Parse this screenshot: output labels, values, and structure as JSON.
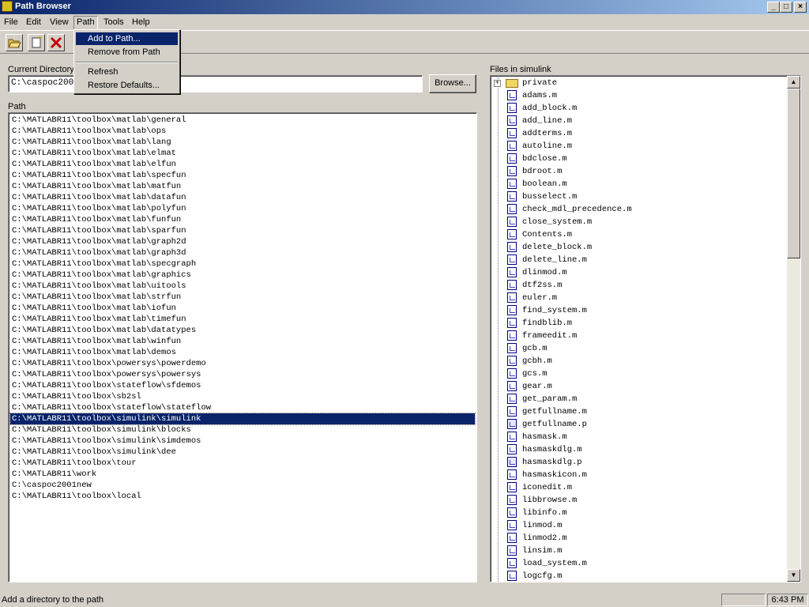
{
  "window": {
    "title": "Path Browser",
    "status": "Add a directory to the path",
    "time": "6:43 PM"
  },
  "menu": [
    "File",
    "Edit",
    "View",
    "Path",
    "Tools",
    "Help"
  ],
  "path_menu": {
    "add": "Add to Path...",
    "remove": "Remove from Path",
    "refresh": "Refresh",
    "restore": "Restore Defaults..."
  },
  "current_directory": {
    "label": "Current Directory",
    "value": "C:\\caspoc2001new",
    "browse": "Browse..."
  },
  "path": {
    "label": "Path",
    "selected_index": 27,
    "items": [
      "C:\\MATLABR11\\toolbox\\matlab\\general",
      "C:\\MATLABR11\\toolbox\\matlab\\ops",
      "C:\\MATLABR11\\toolbox\\matlab\\lang",
      "C:\\MATLABR11\\toolbox\\matlab\\elmat",
      "C:\\MATLABR11\\toolbox\\matlab\\elfun",
      "C:\\MATLABR11\\toolbox\\matlab\\specfun",
      "C:\\MATLABR11\\toolbox\\matlab\\matfun",
      "C:\\MATLABR11\\toolbox\\matlab\\datafun",
      "C:\\MATLABR11\\toolbox\\matlab\\polyfun",
      "C:\\MATLABR11\\toolbox\\matlab\\funfun",
      "C:\\MATLABR11\\toolbox\\matlab\\sparfun",
      "C:\\MATLABR11\\toolbox\\matlab\\graph2d",
      "C:\\MATLABR11\\toolbox\\matlab\\graph3d",
      "C:\\MATLABR11\\toolbox\\matlab\\specgraph",
      "C:\\MATLABR11\\toolbox\\matlab\\graphics",
      "C:\\MATLABR11\\toolbox\\matlab\\uitools",
      "C:\\MATLABR11\\toolbox\\matlab\\strfun",
      "C:\\MATLABR11\\toolbox\\matlab\\iofun",
      "C:\\MATLABR11\\toolbox\\matlab\\timefun",
      "C:\\MATLABR11\\toolbox\\matlab\\datatypes",
      "C:\\MATLABR11\\toolbox\\matlab\\winfun",
      "C:\\MATLABR11\\toolbox\\matlab\\demos",
      "C:\\MATLABR11\\toolbox\\powersys\\powerdemo",
      "C:\\MATLABR11\\toolbox\\powersys\\powersys",
      "C:\\MATLABR11\\toolbox\\stateflow\\sfdemos",
      "C:\\MATLABR11\\toolbox\\sb2sl",
      "C:\\MATLABR11\\toolbox\\stateflow\\stateflow",
      "C:\\MATLABR11\\toolbox\\simulink\\simulink",
      "C:\\MATLABR11\\toolbox\\simulink\\blocks",
      "C:\\MATLABR11\\toolbox\\simulink\\simdemos",
      "C:\\MATLABR11\\toolbox\\simulink\\dee",
      "C:\\MATLABR11\\toolbox\\tour",
      "C:\\MATLABR11\\work",
      "C:\\caspoc2001new",
      "C:\\MATLABR11\\toolbox\\local"
    ]
  },
  "files": {
    "label": "Files in simulink",
    "items": [
      {
        "name": "private",
        "kind": "folder"
      },
      {
        "name": "adams.m",
        "kind": "m"
      },
      {
        "name": "add_block.m",
        "kind": "m"
      },
      {
        "name": "add_line.m",
        "kind": "m"
      },
      {
        "name": "addterms.m",
        "kind": "m"
      },
      {
        "name": "autoline.m",
        "kind": "m"
      },
      {
        "name": "bdclose.m",
        "kind": "m"
      },
      {
        "name": "bdroot.m",
        "kind": "m"
      },
      {
        "name": "boolean.m",
        "kind": "m"
      },
      {
        "name": "busselect.m",
        "kind": "m"
      },
      {
        "name": "check_mdl_precedence.m",
        "kind": "m"
      },
      {
        "name": "close_system.m",
        "kind": "m"
      },
      {
        "name": "Contents.m",
        "kind": "m"
      },
      {
        "name": "delete_block.m",
        "kind": "m"
      },
      {
        "name": "delete_line.m",
        "kind": "m"
      },
      {
        "name": "dlinmod.m",
        "kind": "m"
      },
      {
        "name": "dtf2ss.m",
        "kind": "m"
      },
      {
        "name": "euler.m",
        "kind": "m"
      },
      {
        "name": "find_system.m",
        "kind": "m"
      },
      {
        "name": "findblib.m",
        "kind": "m"
      },
      {
        "name": "frameedit.m",
        "kind": "m"
      },
      {
        "name": "gcb.m",
        "kind": "m"
      },
      {
        "name": "gcbh.m",
        "kind": "m"
      },
      {
        "name": "gcs.m",
        "kind": "m"
      },
      {
        "name": "gear.m",
        "kind": "m"
      },
      {
        "name": "get_param.m",
        "kind": "m"
      },
      {
        "name": "getfullname.m",
        "kind": "m"
      },
      {
        "name": "getfullname.p",
        "kind": "p"
      },
      {
        "name": "hasmask.m",
        "kind": "m"
      },
      {
        "name": "hasmaskdlg.m",
        "kind": "m"
      },
      {
        "name": "hasmaskdlg.p",
        "kind": "p"
      },
      {
        "name": "hasmaskicon.m",
        "kind": "m"
      },
      {
        "name": "iconedit.m",
        "kind": "m"
      },
      {
        "name": "libbrowse.m",
        "kind": "m"
      },
      {
        "name": "libinfo.m",
        "kind": "m"
      },
      {
        "name": "linmod.m",
        "kind": "m"
      },
      {
        "name": "linmod2.m",
        "kind": "m"
      },
      {
        "name": "linsim.m",
        "kind": "m"
      },
      {
        "name": "load_system.m",
        "kind": "m"
      },
      {
        "name": "logcfg.m",
        "kind": "m"
      }
    ]
  }
}
